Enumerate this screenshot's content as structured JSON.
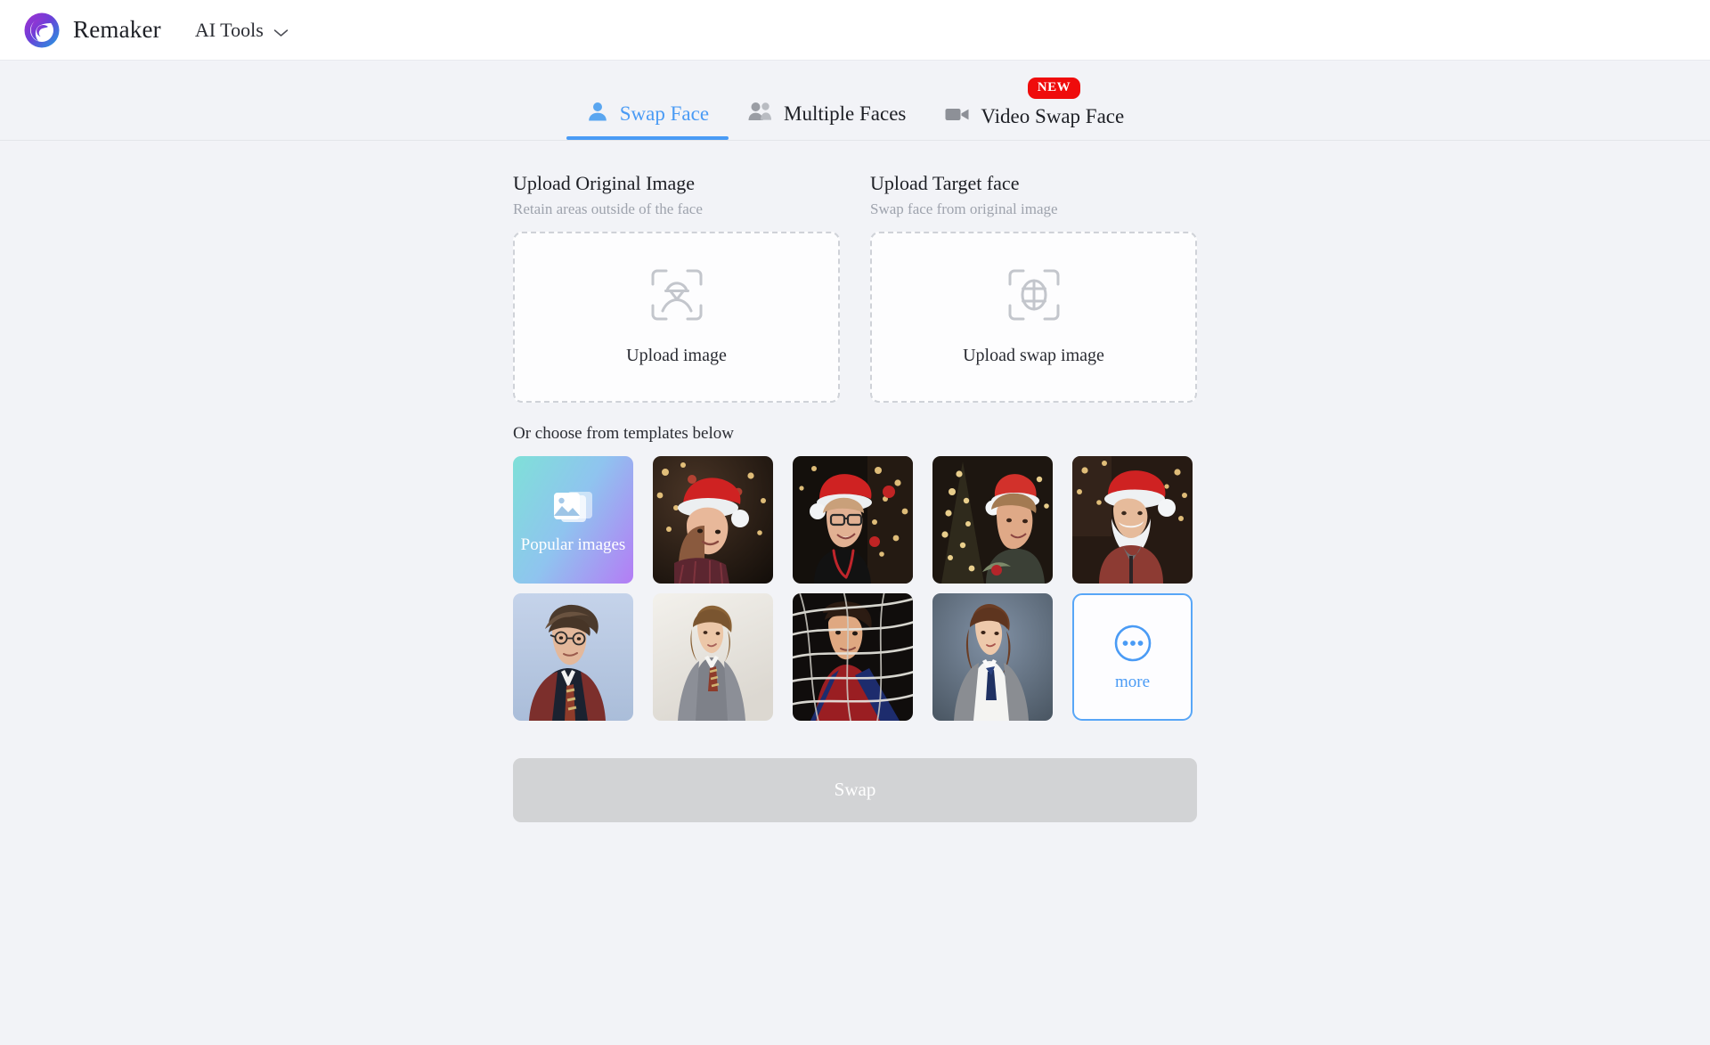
{
  "header": {
    "logo_icon": "remaker-swirl-logo",
    "brand_name": "Remaker",
    "menu_label": "AI Tools",
    "menu_chevron_icon": "chevron-down-icon"
  },
  "tabs": [
    {
      "label": "Swap Face",
      "icon": "single-person-icon",
      "active": true,
      "badge": ""
    },
    {
      "label": "Multiple Faces",
      "icon": "multiple-people-icon",
      "active": false,
      "badge": ""
    },
    {
      "label": "Video Swap Face",
      "icon": "video-camera-icon",
      "active": false,
      "badge": "NEW"
    }
  ],
  "upload": {
    "original": {
      "title": "Upload Original Image",
      "subtitle": "Retain areas outside of the face",
      "icon": "face-scan-frame-icon",
      "button_label": "Upload image"
    },
    "target": {
      "title": "Upload Target face",
      "subtitle": "Swap face from original image",
      "icon": "face-grid-frame-icon",
      "button_label": "Upload swap image"
    }
  },
  "templates": {
    "hint": "Or choose from templates below",
    "popular": {
      "label": "Popular images",
      "icon": "stacked-photos-icon",
      "gradient_from": "#7fe0d8",
      "gradient_to": "#b47cf5"
    },
    "items": [
      {
        "name": "christmas-girl-santa-hat"
      },
      {
        "name": "christmas-woman-glasses-santa-hat"
      },
      {
        "name": "christmas-woman-tree-lights"
      },
      {
        "name": "christmas-santa-man-beard"
      },
      {
        "name": "wizard-boy-portrait"
      },
      {
        "name": "wizard-girl-portrait"
      },
      {
        "name": "spider-hero-webs-portrait"
      },
      {
        "name": "schoolgirl-uniform-portrait"
      }
    ],
    "more": {
      "label": "more",
      "icon": "three-dots-circle-icon",
      "accent": "#4a9bf5"
    }
  },
  "actions": {
    "swap_label": "Swap",
    "swap_disabled": true
  },
  "colors": {
    "accent": "#4a9bf5",
    "badge_red": "#ef0c0c",
    "page_bg": "#f2f3f7",
    "disabled_button": "#d2d3d5"
  }
}
